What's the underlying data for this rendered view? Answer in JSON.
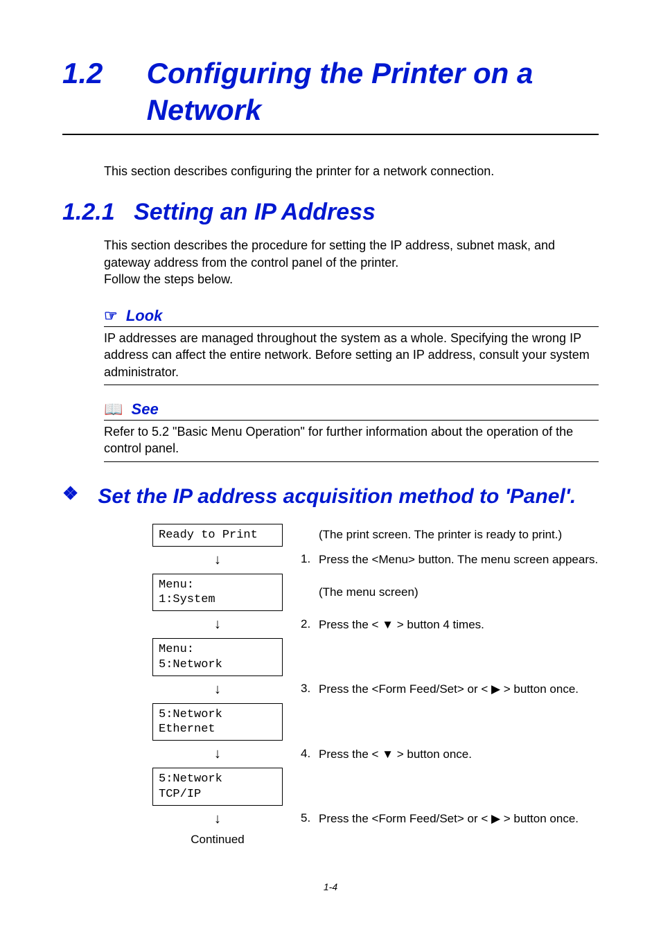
{
  "heading": {
    "number": "1.2",
    "title": "Configuring the Printer on a Network"
  },
  "intro": "This section describes configuring the printer for a network connection.",
  "sub_heading": {
    "number": "1.2.1",
    "title": "Setting an IP Address"
  },
  "sub_intro": "This section describes the procedure for setting the IP address, subnet mask, and gateway address from the control panel of the printer.\nFollow the steps below.",
  "look": {
    "icon": "☞",
    "label": "Look",
    "text": "IP addresses are managed throughout the system as a whole. Specifying the wrong IP address can affect the entire network. Before setting an IP address, consult your system administrator."
  },
  "see": {
    "icon": "📖",
    "label": "See",
    "text": "Refer to 5.2 \"Basic Menu Operation\" for further information about the operation of the control panel."
  },
  "section_title": {
    "diamond": "❖",
    "text": "Set the IP address acquisition method to 'Panel'."
  },
  "steps": {
    "lcd0": "Ready to Print",
    "note0": "(The print screen. The printer is ready to print.)",
    "step1_num": "1.",
    "step1": "Press the <Menu> button. The menu screen appears.",
    "lcd1a": "Menu:",
    "lcd1b": "1:System",
    "note1": "(The menu screen)",
    "step2_num": "2.",
    "step2": "Press the < ▼ > button 4 times.",
    "lcd2a": "Menu:",
    "lcd2b": "5:Network",
    "step3_num": "3.",
    "step3": "Press the <Form Feed/Set> or < ▶ > button once.",
    "lcd3a": "5:Network",
    "lcd3b": "Ethernet",
    "step4_num": "4.",
    "step4": "Press the < ▼ > button once.",
    "lcd4a": "5:Network",
    "lcd4b": "TCP/IP",
    "step5_num": "5.",
    "step5": "Press the <Form Feed/Set> or < ▶ > button once.",
    "continued": "Continued",
    "arrow": "↓"
  },
  "page_number": "1-4"
}
